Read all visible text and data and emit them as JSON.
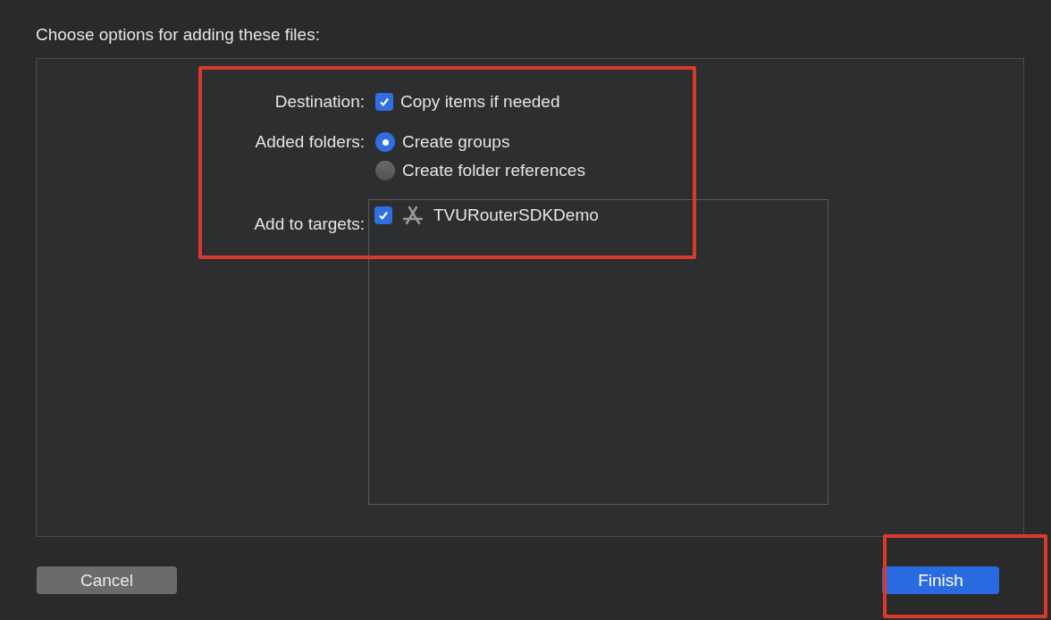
{
  "title": "Choose options for adding these files:",
  "destination": {
    "label": "Destination:",
    "option": {
      "label": "Copy items if needed",
      "checked": true
    }
  },
  "added_folders": {
    "label": "Added folders:",
    "options": [
      {
        "label": "Create groups",
        "selected": true
      },
      {
        "label": "Create folder references",
        "selected": false
      }
    ]
  },
  "targets": {
    "label": "Add to targets:",
    "items": [
      {
        "label": "TVURouterSDKDemo",
        "checked": true
      }
    ]
  },
  "buttons": [
    {
      "label": "Cancel",
      "kind": "secondary"
    },
    {
      "label": "Finish",
      "kind": "primary"
    }
  ]
}
